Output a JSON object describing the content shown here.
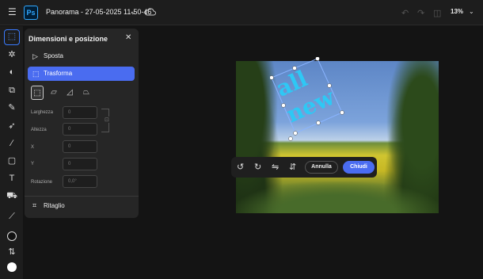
{
  "header": {
    "menu_icon": "hamburger-icon",
    "app_logo": "Ps",
    "document_title": "Panorama - 27-05-2025 11-50-46",
    "zoom": "13%",
    "colors": {
      "brand": "#31a8ff",
      "accent": "#4a6cf0"
    }
  },
  "toolbar": {
    "tools": [
      "select-icon",
      "brush-spot-icon",
      "adjust-icon",
      "generate-icon",
      "heal-icon",
      "rocket-icon",
      "brush-icon",
      "shape-icon",
      "text-icon",
      "fill-icon",
      "eyedropper-icon"
    ],
    "foreground_color": "#111111",
    "background_color": "#ffffff"
  },
  "panel": {
    "title": "Dimensioni e posizione",
    "items": [
      {
        "label": "Sposta"
      },
      {
        "label": "Trasforma"
      }
    ],
    "fields": [
      {
        "label": "Larghezza",
        "value": "0"
      },
      {
        "label": "Altezza",
        "value": "0"
      },
      {
        "label": "X",
        "value": "0"
      },
      {
        "label": "Y",
        "value": "0"
      },
      {
        "label": "Rotazione",
        "value": "0,0°"
      }
    ],
    "crop_label": "Ritaglio"
  },
  "canvas": {
    "text_layer": [
      "all",
      "new"
    ]
  },
  "contextbar": {
    "cancel_label": "Annulla",
    "close_label": "Chiudi"
  }
}
